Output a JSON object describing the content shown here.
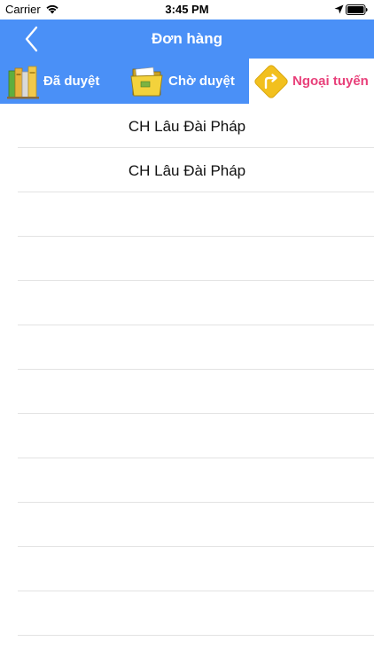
{
  "status_bar": {
    "carrier": "Carrier",
    "time": "3:45 PM"
  },
  "nav": {
    "title": "Đơn hàng",
    "back_icon": "chevron-left-icon"
  },
  "tabs": [
    {
      "label": "Đã duyệt",
      "icon": "books-icon",
      "selected": false
    },
    {
      "label": "Chờ duyệt",
      "icon": "folder-icon",
      "selected": false
    },
    {
      "label": "Ngoại tuyến",
      "icon": "turn-right-sign-icon",
      "selected": true
    }
  ],
  "orders": [
    {
      "name": "CH Lâu Đài Pháp"
    },
    {
      "name": "CH Lâu Đài Pháp"
    },
    {
      "name": ""
    },
    {
      "name": ""
    },
    {
      "name": ""
    },
    {
      "name": ""
    },
    {
      "name": ""
    },
    {
      "name": ""
    },
    {
      "name": ""
    },
    {
      "name": ""
    },
    {
      "name": ""
    },
    {
      "name": ""
    }
  ],
  "colors": {
    "accent": "#4a90f7",
    "selected_tab_text": "#e8407a",
    "sign_yellow": "#f2c01e"
  }
}
